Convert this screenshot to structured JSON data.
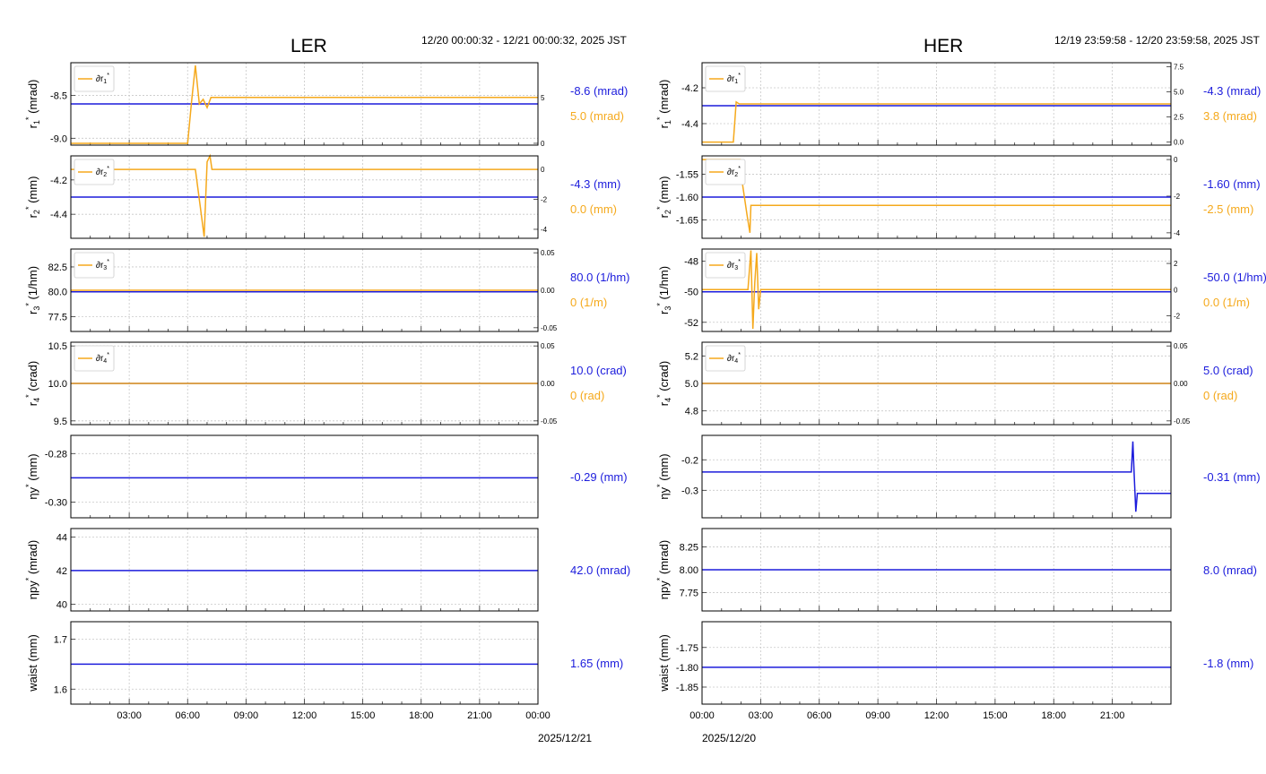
{
  "left": {
    "title": "LER",
    "time_range": "12/20 00:00:32 - 12/21 00:00:32, 2025 JST",
    "date_label": "2025/12/21",
    "x_ticks": [
      "03:00",
      "06:00",
      "09:00",
      "12:00",
      "15:00",
      "18:00",
      "21:00",
      "00:00"
    ]
  },
  "right": {
    "title": "HER",
    "time_range": "12/19 23:59:58 - 12/20 23:59:58, 2025 JST",
    "date_label": "2025/12/20",
    "x_ticks": [
      "00:00",
      "03:00",
      "06:00",
      "09:00",
      "12:00",
      "15:00",
      "18:00",
      "21:00"
    ]
  },
  "colors": {
    "setpoint": "#1c1cdc",
    "delta": "#f5a91c",
    "frame": "#000000",
    "grid": "#c8c8c8"
  },
  "chart_data": [
    {
      "type": "line",
      "panel": "LER r1*",
      "ylabel": "r₁* (mrad)",
      "legend": "∂r₁*",
      "legend_position": "top-left",
      "ylim": [
        -9.08,
        -8.12
      ],
      "yticks": [
        "-9.0",
        "-8.5"
      ],
      "yticks_values": [
        -9.0,
        -8.5
      ],
      "ylim2": [
        -0.2,
        8.8
      ],
      "yticks2": [
        "0",
        "5"
      ],
      "yticks2_values": [
        0,
        5
      ],
      "readout_main": "-8.6 (mrad)",
      "readout_delta": "5.0 (mrad)",
      "series": [
        {
          "name": "",
          "axis": "left",
          "x": [
            0,
            24
          ],
          "y": [
            -8.6,
            -8.6
          ]
        },
        {
          "name": "∂r₁*",
          "axis": "right",
          "x": [
            0,
            6.0,
            6.2,
            6.4,
            6.6,
            6.8,
            7.0,
            7.2,
            24
          ],
          "y": [
            0,
            0,
            4.5,
            8.5,
            4.3,
            4.8,
            3.9,
            5.0,
            5.0
          ]
        }
      ]
    },
    {
      "type": "line",
      "panel": "LER r2*",
      "ylabel": "r₂* (mm)",
      "legend": "∂r₂*",
      "legend_position": "top-left",
      "ylim": [
        -4.54,
        -4.06
      ],
      "yticks": [
        "-4.4",
        "-4.2"
      ],
      "yticks_values": [
        -4.4,
        -4.2
      ],
      "ylim2": [
        -4.6,
        0.9
      ],
      "yticks2": [
        "-4",
        "-2",
        "0"
      ],
      "yticks2_values": [
        -4,
        -2,
        0
      ],
      "readout_main": "-4.3 (mm)",
      "readout_delta": "0.0 (mm)",
      "series": [
        {
          "name": "",
          "axis": "left",
          "x": [
            0,
            24
          ],
          "y": [
            -4.3,
            -4.3
          ]
        },
        {
          "name": "∂r₂*",
          "axis": "right",
          "x": [
            0,
            6.4,
            6.65,
            6.85,
            7.0,
            7.15,
            7.25,
            24
          ],
          "y": [
            0,
            0,
            -2.5,
            -4.5,
            0.5,
            0.9,
            0,
            0
          ]
        }
      ]
    },
    {
      "type": "line",
      "panel": "LER r3*",
      "ylabel": "r₃* (1/hm)",
      "legend": "∂r₃*",
      "legend_position": "top-left",
      "ylim": [
        76.0,
        84.3
      ],
      "yticks": [
        "77.5",
        "80.0",
        "82.5"
      ],
      "yticks_values": [
        77.5,
        80.0,
        82.5
      ],
      "ylim2": [
        -0.055,
        0.055
      ],
      "yticks2": [
        "-0.05",
        "0.00",
        "0.05"
      ],
      "yticks2_values": [
        -0.05,
        0.0,
        0.05
      ],
      "readout_main": "80.0 (1/hm)",
      "readout_delta": "0 (1/m)",
      "series": [
        {
          "name": "",
          "axis": "left",
          "x": [
            0,
            24
          ],
          "y": [
            80.0,
            80.0
          ]
        },
        {
          "name": "∂r₃*",
          "axis": "right",
          "x": [
            0,
            24
          ],
          "y": [
            0,
            0
          ]
        }
      ]
    },
    {
      "type": "line",
      "panel": "LER r4*",
      "ylabel": "r₄* (crad)",
      "legend": "∂r₄*",
      "legend_position": "top-left",
      "ylim": [
        9.45,
        10.55
      ],
      "yticks": [
        "9.5",
        "10.0",
        "10.5"
      ],
      "yticks_values": [
        9.5,
        10.0,
        10.5
      ],
      "ylim2": [
        -0.055,
        0.055
      ],
      "yticks2": [
        "-0.05",
        "0.00",
        "0.05"
      ],
      "yticks2_values": [
        -0.05,
        0.0,
        0.05
      ],
      "readout_main": "10.0 (crad)",
      "readout_delta": "0 (rad)",
      "series": [
        {
          "name": "",
          "axis": "left",
          "x": [
            0,
            24
          ],
          "y": [
            10.0,
            10.0
          ]
        },
        {
          "name": "∂r₄*",
          "axis": "right",
          "x": [
            0,
            24
          ],
          "y": [
            0,
            0
          ]
        }
      ]
    },
    {
      "type": "line",
      "panel": "LER eta_y*",
      "ylabel": "ηy* (mm)",
      "legend": "",
      "legend_position": "",
      "ylim": [
        -0.3065,
        -0.2725
      ],
      "yticks": [
        "-0.30",
        "-0.28"
      ],
      "yticks_values": [
        -0.3,
        -0.28
      ],
      "readout_main": "-0.29 (mm)",
      "readout_delta": "",
      "series": [
        {
          "name": "",
          "axis": "left",
          "x": [
            0,
            24
          ],
          "y": [
            -0.29,
            -0.29
          ]
        }
      ]
    },
    {
      "type": "line",
      "panel": "LER eta_py*",
      "ylabel": "ηpy* (mrad)",
      "legend": "",
      "legend_position": "",
      "ylim": [
        39.6,
        44.5
      ],
      "yticks": [
        "40",
        "42",
        "44"
      ],
      "yticks_values": [
        40,
        42,
        44
      ],
      "readout_main": "42.0 (mrad)",
      "readout_delta": "",
      "series": [
        {
          "name": "",
          "axis": "left",
          "x": [
            0,
            24
          ],
          "y": [
            42.0,
            42.0
          ]
        }
      ]
    },
    {
      "type": "line",
      "panel": "LER waist",
      "ylabel": "waist (mm)",
      "legend": "",
      "legend_position": "",
      "ylim": [
        1.57,
        1.735
      ],
      "yticks": [
        "1.6",
        "1.7"
      ],
      "yticks_values": [
        1.6,
        1.7
      ],
      "readout_main": "1.65 (mm)",
      "readout_delta": "",
      "series": [
        {
          "name": "",
          "axis": "left",
          "x": [
            0,
            24
          ],
          "y": [
            1.65,
            1.65
          ]
        }
      ]
    },
    {
      "type": "line",
      "panel": "HER r1*",
      "ylabel": "r₁* (mrad)",
      "legend": "∂r₁*",
      "legend_position": "top-left",
      "ylim": [
        -4.52,
        -4.06
      ],
      "yticks": [
        "-4.4",
        "-4.2"
      ],
      "yticks_values": [
        -4.4,
        -4.2
      ],
      "ylim2": [
        -0.3,
        7.9
      ],
      "yticks2": [
        "0.0",
        "2.5",
        "5.0",
        "7.5"
      ],
      "yticks2_values": [
        0.0,
        2.5,
        5.0,
        7.5
      ],
      "readout_main": "-4.3 (mrad)",
      "readout_delta": "3.8 (mrad)",
      "series": [
        {
          "name": "",
          "axis": "left",
          "x": [
            0,
            24
          ],
          "y": [
            -4.3,
            -4.3
          ]
        },
        {
          "name": "∂r₁*",
          "axis": "right",
          "x": [
            0,
            1.6,
            1.75,
            1.9,
            24
          ],
          "y": [
            0,
            0,
            4.0,
            3.8,
            3.8
          ]
        }
      ]
    },
    {
      "type": "line",
      "panel": "HER r2*",
      "ylabel": "r₂* (mm)",
      "legend": "∂r₂*",
      "legend_position": "top-left",
      "ylim": [
        -1.69,
        -1.51
      ],
      "yticks": [
        "-1.65",
        "-1.60",
        "-1.55"
      ],
      "yticks_values": [
        -1.65,
        -1.6,
        -1.55
      ],
      "ylim2": [
        -4.3,
        0.2
      ],
      "yticks2": [
        "-4",
        "-2",
        "0"
      ],
      "yticks2_values": [
        -4,
        -2,
        0
      ],
      "readout_main": "-1.60 (mm)",
      "readout_delta": "-2.5 (mm)",
      "series": [
        {
          "name": "",
          "axis": "left",
          "x": [
            0,
            24
          ],
          "y": [
            -1.6,
            -1.6
          ]
        },
        {
          "name": "∂r₂*",
          "axis": "right",
          "x": [
            0,
            1.95,
            2.05,
            2.3,
            2.45,
            2.5,
            24
          ],
          "y": [
            0,
            0,
            -1.2,
            -3.0,
            -4.0,
            -2.5,
            -2.5
          ]
        }
      ]
    },
    {
      "type": "line",
      "panel": "HER r3*",
      "ylabel": "r₃* (1/hm)",
      "legend": "∂r₃*",
      "legend_position": "top-left",
      "ylim": [
        -52.6,
        -47.2
      ],
      "yticks": [
        "-52",
        "-50",
        "-48"
      ],
      "yticks_values": [
        -52,
        -50,
        -48
      ],
      "ylim2": [
        -3.2,
        3.1
      ],
      "yticks2": [
        "-2",
        "0",
        "2"
      ],
      "yticks2_values": [
        -2,
        0,
        2
      ],
      "readout_main": "-50.0 (1/hm)",
      "readout_delta": "0.0 (1/m)",
      "series": [
        {
          "name": "",
          "axis": "left",
          "x": [
            0,
            24
          ],
          "y": [
            -50.0,
            -50.0
          ]
        },
        {
          "name": "∂r₃*",
          "axis": "right",
          "x": [
            0,
            2.35,
            2.5,
            2.6,
            2.7,
            2.8,
            2.9,
            3.0,
            24
          ],
          "y": [
            0,
            0,
            3.0,
            -3.0,
            0.5,
            2.8,
            -1.5,
            0,
            0
          ]
        }
      ]
    },
    {
      "type": "line",
      "panel": "HER r4*",
      "ylabel": "r₄* (crad)",
      "legend": "∂r₄*",
      "legend_position": "top-left",
      "ylim": [
        4.7,
        5.3
      ],
      "yticks": [
        "4.8",
        "5.0",
        "5.2"
      ],
      "yticks_values": [
        4.8,
        5.0,
        5.2
      ],
      "ylim2": [
        -0.055,
        0.055
      ],
      "yticks2": [
        "-0.05",
        "0.00",
        "0.05"
      ],
      "yticks2_values": [
        -0.05,
        0.0,
        0.05
      ],
      "readout_main": "5.0 (crad)",
      "readout_delta": "0 (rad)",
      "series": [
        {
          "name": "",
          "axis": "left",
          "x": [
            0,
            24
          ],
          "y": [
            5.0,
            5.0
          ]
        },
        {
          "name": "∂r₄*",
          "axis": "right",
          "x": [
            0,
            24
          ],
          "y": [
            0,
            0
          ]
        }
      ]
    },
    {
      "type": "line",
      "panel": "HER eta_y*",
      "ylabel": "ηy* (mm)",
      "legend": "",
      "legend_position": "",
      "ylim": [
        -0.39,
        -0.12
      ],
      "yticks": [
        "-0.3",
        "-0.2"
      ],
      "yticks_values": [
        -0.3,
        -0.2
      ],
      "readout_main": "-0.31 (mm)",
      "readout_delta": "",
      "series": [
        {
          "name": "",
          "axis": "left",
          "x": [
            0,
            21.97,
            22.05,
            22.12,
            22.2,
            22.28,
            22.35,
            24
          ],
          "y": [
            -0.24,
            -0.24,
            -0.14,
            -0.25,
            -0.37,
            -0.31,
            -0.31,
            -0.31
          ]
        }
      ]
    },
    {
      "type": "line",
      "panel": "HER eta_py*",
      "ylabel": "ηpy* (mrad)",
      "legend": "",
      "legend_position": "",
      "ylim": [
        7.55,
        8.45
      ],
      "yticks": [
        "7.75",
        "8.00",
        "8.25"
      ],
      "yticks_values": [
        7.75,
        8.0,
        8.25
      ],
      "readout_main": "8.0 (mrad)",
      "readout_delta": "",
      "series": [
        {
          "name": "",
          "axis": "left",
          "x": [
            0,
            24
          ],
          "y": [
            8.0,
            8.0
          ]
        }
      ]
    },
    {
      "type": "line",
      "panel": "HER waist",
      "ylabel": "waist (mm)",
      "legend": "",
      "legend_position": "",
      "ylim": [
        -1.893,
        -1.685
      ],
      "yticks": [
        "-1.85",
        "-1.80",
        "-1.75"
      ],
      "yticks_values": [
        -1.85,
        -1.8,
        -1.75
      ],
      "readout_main": "-1.8 (mm)",
      "readout_delta": "",
      "series": [
        {
          "name": "",
          "axis": "left",
          "x": [
            0,
            24
          ],
          "y": [
            -1.8,
            -1.8
          ]
        }
      ]
    }
  ]
}
